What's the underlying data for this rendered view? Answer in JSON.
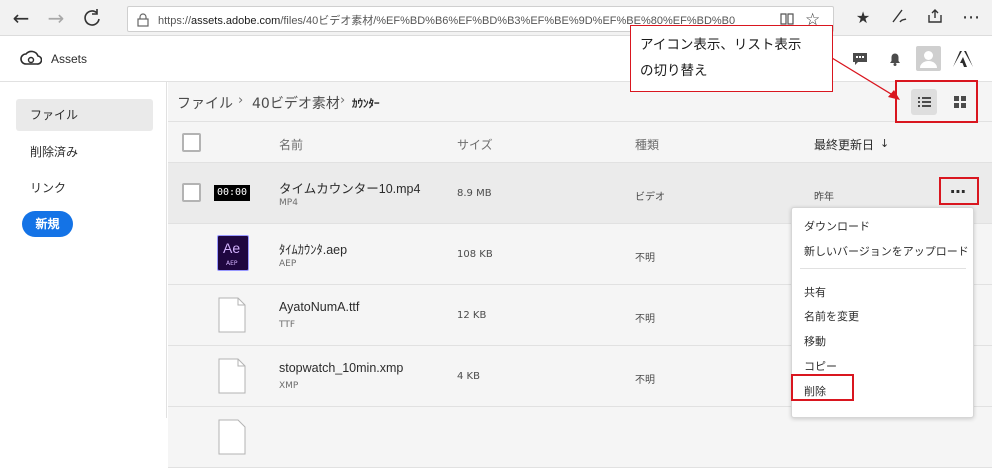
{
  "browser": {
    "url_prefix": "https://",
    "url_host": "assets.adobe.com",
    "url_rest": "/files/40ビデオ素材/%EF%BD%B6%EF%BD%B3%EF%BE%9D%EF%BE%80%EF%BD%B0"
  },
  "app": {
    "name": "Assets"
  },
  "sidebar": {
    "items": [
      {
        "label": "ファイル"
      },
      {
        "label": "削除済み"
      },
      {
        "label": "リンク"
      }
    ],
    "new_label": "新規"
  },
  "breadcrumb": {
    "root": "ファイル",
    "folder": "40ビデオ素材",
    "current": "ｶｳﾝﾀｰ"
  },
  "table": {
    "headers": {
      "name": "名前",
      "size": "サイズ",
      "kind": "種類",
      "modified": "最終更新日"
    },
    "sort_icon": "arrow-down-icon",
    "rows": [
      {
        "name": "タイムカウンター10.mp4",
        "type": "MP4",
        "size": "8.9 MB",
        "kind": "ビデオ",
        "date": "昨年",
        "thumb": "00:00"
      },
      {
        "name": "ﾀｲﾑｶｳﾝﾀ.aep",
        "type": "AEP",
        "size": "108 KB",
        "kind": "不明",
        "date": "",
        "thumb": "Ae",
        "thumb_sub": "AEP"
      },
      {
        "name": "AyatoNumA.ttf",
        "type": "TTF",
        "size": "12 KB",
        "kind": "不明",
        "date": ""
      },
      {
        "name": "stopwatch_10min.xmp",
        "type": "XMP",
        "size": "4 KB",
        "kind": "不明",
        "date": ""
      }
    ]
  },
  "menu": {
    "items": [
      "ダウンロード",
      "新しいバージョンをアップロード",
      "共有",
      "名前を変更",
      "移動",
      "コピー",
      "削除"
    ]
  },
  "annotation": {
    "text": "アイコン表示、リスト表示\nの切り替え"
  },
  "colors": {
    "accent": "#1473e6",
    "annotation": "#d9161f"
  }
}
